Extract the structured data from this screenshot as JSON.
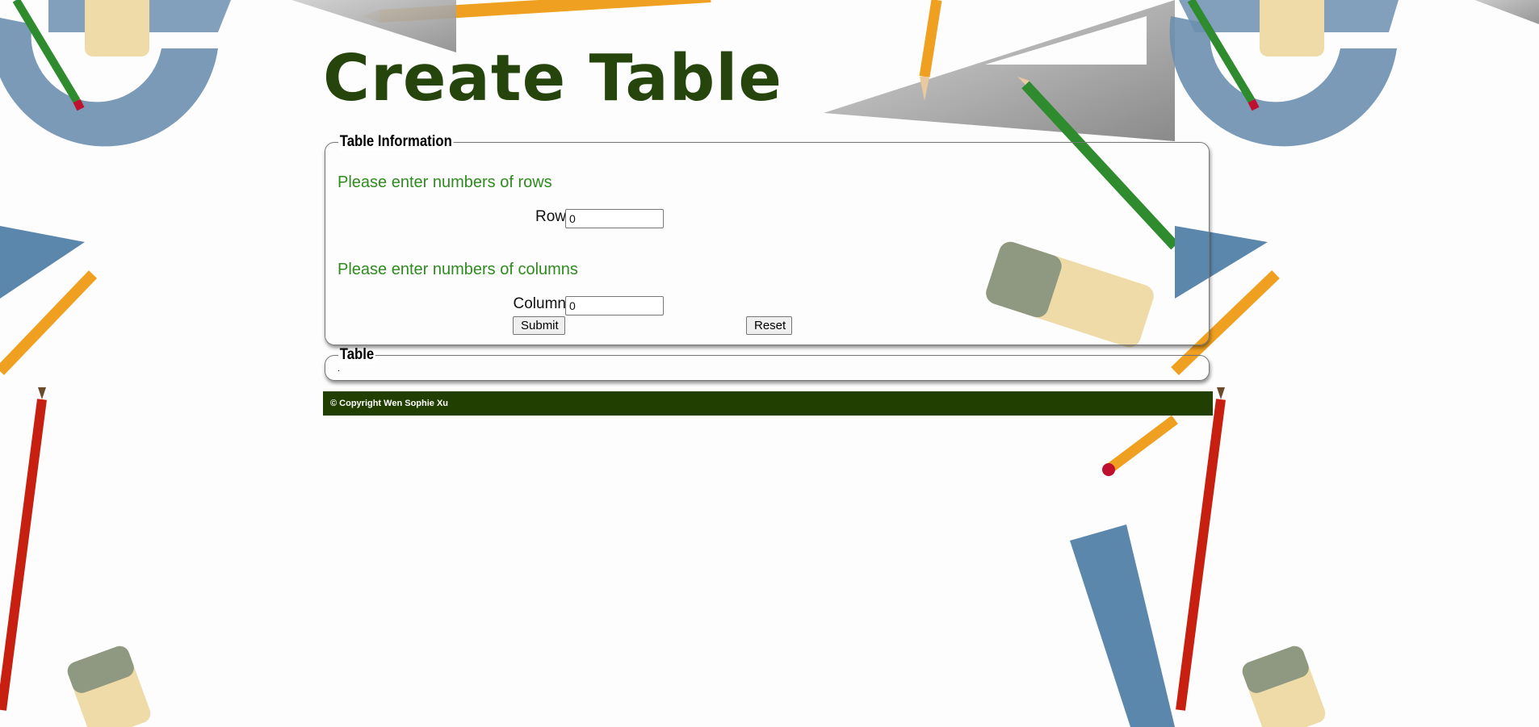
{
  "header": {
    "title": "Create Table"
  },
  "form": {
    "legend": "Table Information",
    "rows_prompt": "Please enter numbers of rows",
    "row_label": "Row",
    "row_value": "0",
    "columns_prompt": "Please enter numbers of columns",
    "column_label": "Column",
    "column_value": "0",
    "submit_label": "Submit",
    "reset_label": "Reset"
  },
  "table_section": {
    "legend": "Table",
    "content": "."
  },
  "footer": {
    "copyright": "© Copyright Wen Sophie Xu"
  },
  "colors": {
    "title": "#26450d",
    "prompt": "#2f8a1f",
    "footer_bg": "#223f02"
  },
  "background": {
    "theme": "drawing tools — pencils, protractors, rulers, set squares, erasers",
    "icons": [
      "protractor-icon",
      "pencil-icon",
      "ruler-icon",
      "set-square-icon",
      "eraser-icon"
    ]
  }
}
